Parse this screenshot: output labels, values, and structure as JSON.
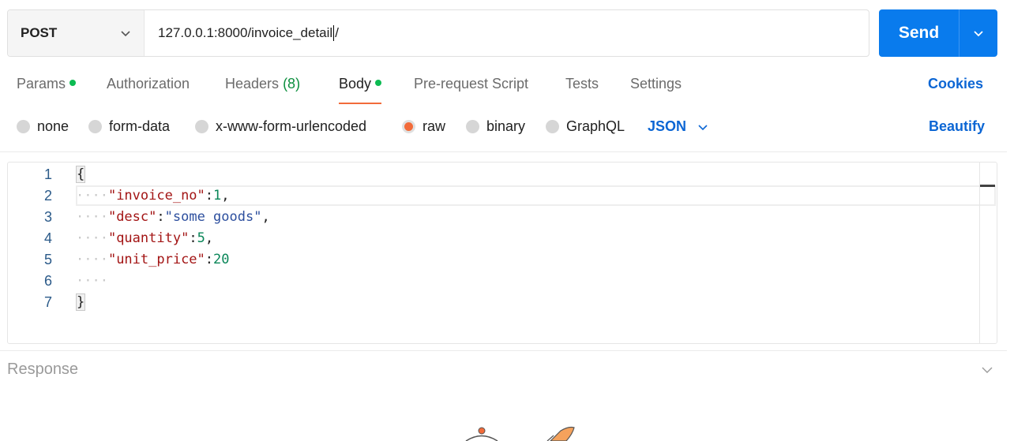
{
  "request": {
    "method": "POST",
    "url_before_caret": "127.0.0.1:8000/invoice_detail",
    "url_after_caret": "/",
    "send_label": "Send"
  },
  "tabs": [
    {
      "label": "Params",
      "dot": true
    },
    {
      "label": "Authorization"
    },
    {
      "label": "Headers",
      "count": "(8)"
    },
    {
      "label": "Body",
      "dot": true,
      "active": true
    },
    {
      "label": "Pre-request Script"
    },
    {
      "label": "Tests"
    },
    {
      "label": "Settings"
    }
  ],
  "cookies_label": "Cookies",
  "body_options": [
    {
      "label": "none",
      "selected": false
    },
    {
      "label": "form-data",
      "selected": false
    },
    {
      "label": "x-www-form-urlencoded",
      "selected": false
    },
    {
      "label": "raw",
      "selected": true
    },
    {
      "label": "binary",
      "selected": false
    },
    {
      "label": "GraphQL",
      "selected": false
    }
  ],
  "format_select": "JSON",
  "beautify_label": "Beautify",
  "editor": {
    "line_numbers": [
      "1",
      "2",
      "3",
      "4",
      "5",
      "6",
      "7"
    ],
    "open_brace": "{",
    "close_brace": "}",
    "lines": [
      {
        "key": "\"invoice_no\"",
        "value": "1",
        "value_type": "number",
        "trailing": ","
      },
      {
        "key": "\"desc\"",
        "value": "\"some goods\"",
        "value_type": "string",
        "trailing": ","
      },
      {
        "key": "\"quantity\"",
        "value": "5",
        "value_type": "number",
        "trailing": ","
      },
      {
        "key": "\"unit_price\"",
        "value": "20",
        "value_type": "number",
        "trailing": ""
      }
    ],
    "indent_marker": "····"
  },
  "response_label": "Response",
  "colors": {
    "send_button": "#097bed",
    "active_tab_underline": "#f26b3a",
    "status_dot": "#0cbb52",
    "link_blue": "#0c66d4",
    "json_key": "#a31515",
    "json_string": "#2d4f9e",
    "json_number": "#098658"
  }
}
